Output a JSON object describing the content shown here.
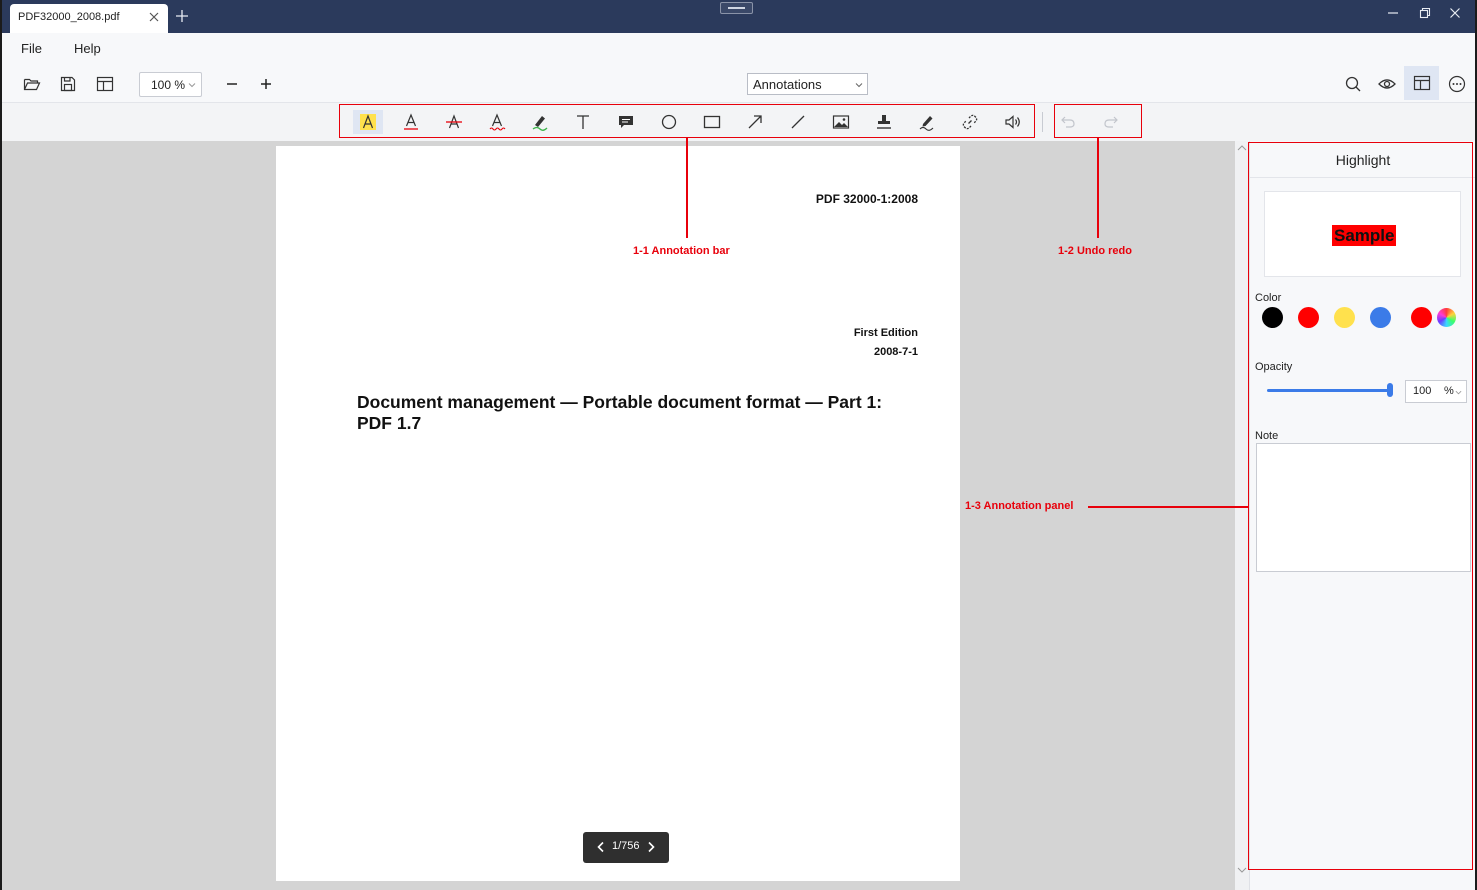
{
  "titlebar": {
    "tab_label": "PDF32000_2008.pdf",
    "new_tab_icon": "plus-icon",
    "window_controls": [
      "minimize-icon",
      "restore-icon",
      "close-icon"
    ]
  },
  "menu": {
    "file": "File",
    "help": "Help"
  },
  "toolbar": {
    "zoom_value": "100 %",
    "mode": "Annotations",
    "left_icons": [
      "open-folder-icon",
      "save-icon",
      "layout-icon"
    ],
    "right_icons": [
      "search-icon",
      "eye-icon",
      "layout-panel-icon",
      "more-icon"
    ]
  },
  "annotation_tools": [
    {
      "name": "highlight-tool",
      "icon": "highlight-icon"
    },
    {
      "name": "underline-tool",
      "icon": "underline-icon"
    },
    {
      "name": "strikeout-tool",
      "icon": "strikeout-icon"
    },
    {
      "name": "squiggly-tool",
      "icon": "squiggly-icon"
    },
    {
      "name": "freehand-tool",
      "icon": "pen-icon"
    },
    {
      "name": "text-tool",
      "icon": "text-icon"
    },
    {
      "name": "note-tool",
      "icon": "comment-icon"
    },
    {
      "name": "circle-tool",
      "icon": "circle-icon"
    },
    {
      "name": "rectangle-tool",
      "icon": "rectangle-icon"
    },
    {
      "name": "arrow-tool",
      "icon": "arrow-icon"
    },
    {
      "name": "line-tool",
      "icon": "line-icon"
    },
    {
      "name": "image-tool",
      "icon": "image-icon"
    },
    {
      "name": "stamp-tool",
      "icon": "stamp-icon"
    },
    {
      "name": "signature-tool",
      "icon": "signature-icon"
    },
    {
      "name": "link-tool",
      "icon": "link-icon"
    },
    {
      "name": "sound-tool",
      "icon": "sound-icon"
    }
  ],
  "history": {
    "undo_icon": "undo-icon",
    "redo_icon": "redo-icon"
  },
  "document": {
    "id": "PDF 32000-1:2008",
    "edition": "First Edition",
    "date": "2008-7-1",
    "title_line1": "Document management — Portable document format — Part 1:",
    "title_line2": "PDF 1.7",
    "page_indicator": "1/756"
  },
  "panel": {
    "title": "Highlight",
    "sample_text": "Sample",
    "color_label": "Color",
    "colors": [
      "#000000",
      "#ff0000",
      "#ffe14d",
      "#3b7be8",
      "#ff0000"
    ],
    "opacity_label": "Opacity",
    "opacity_value": "100",
    "opacity_unit": "%",
    "opacity_fraction": 1.0,
    "note_label": "Note",
    "note_value": ""
  },
  "callouts": {
    "annotation_bar": "1-1 Annotation bar",
    "undo_redo": "1-2 Undo redo",
    "annotation_panel": "1-3 Annotation panel"
  },
  "colors": {
    "titlebar": "#2b3a5c",
    "accent": "#3b7be8",
    "callout": "#e8000b",
    "highlight": "#ff0000"
  }
}
